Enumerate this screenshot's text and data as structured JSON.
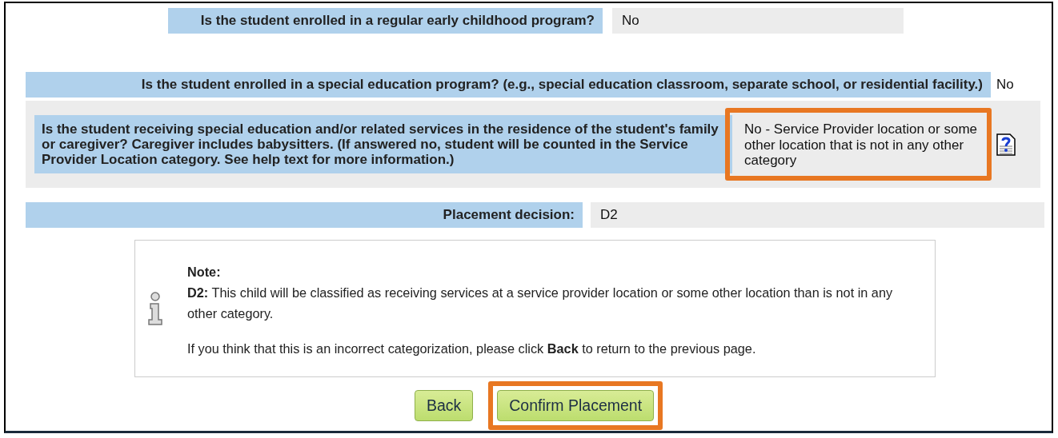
{
  "rows": [
    {
      "kind": "narrow",
      "label": "Is the student enrolled in a regular early childhood program?",
      "value": "No",
      "highlighted": false
    },
    {
      "kind": "wide",
      "label": "Is the student enrolled in a special education program? (e.g., special education classroom, separate school, or residential facility.)",
      "value": "No",
      "highlighted": false
    },
    {
      "kind": "panel",
      "label": "Is the student receiving special education and/or related services in the residence of the student's family or caregiver? Caregiver includes babysitters. (If answered no, student will be counted in the Service Provider Location category. See help text for more information.)",
      "value": "No - Service Provider location or some other location that is not in any other category",
      "highlighted": true,
      "help": true
    },
    {
      "kind": "decision",
      "label": "Placement decision:",
      "value": "D2",
      "highlighted": false
    }
  ],
  "note": {
    "title": "Note:",
    "body": "**D2:** This child will be classified as receiving services at a service provider location or some other location than is not in any other category.",
    "footer": "If you think that this is an incorrect categorization, please click **Back** to return to the previous page."
  },
  "buttons": [
    {
      "label": "Back",
      "highlighted": false
    },
    {
      "label": "Confirm Placement",
      "highlighted": true
    }
  ]
}
